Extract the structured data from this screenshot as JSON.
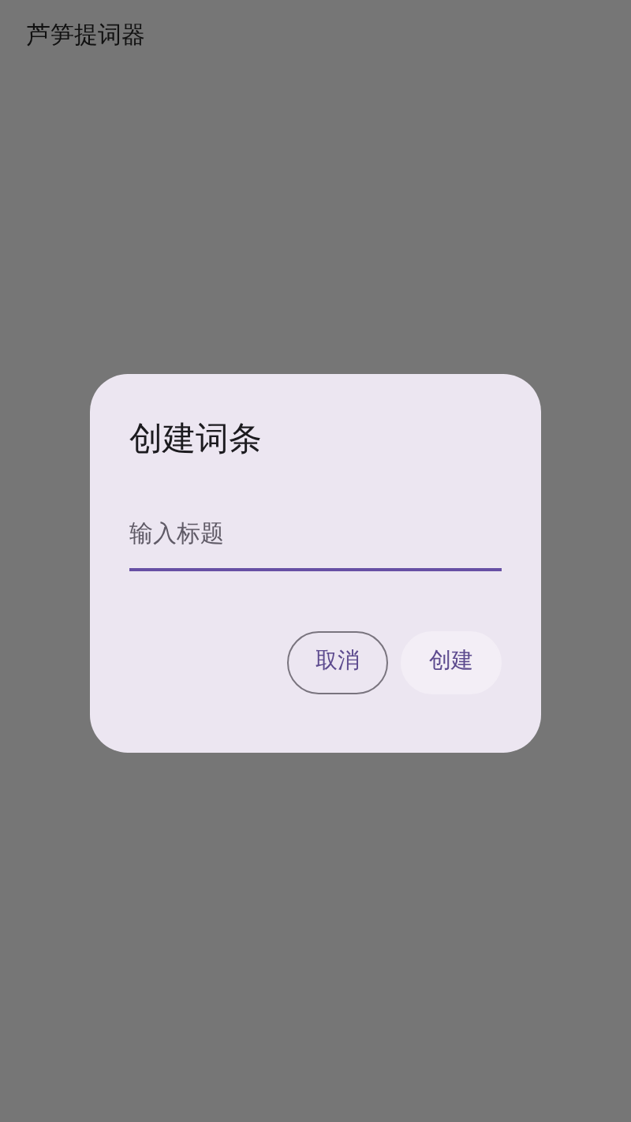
{
  "app_bar": {
    "title": "芦笋提词器"
  },
  "dialog": {
    "title": "创建词条",
    "field": {
      "placeholder": "输入标题"
    },
    "buttons": [
      {
        "label": "取消",
        "kind": "outlined"
      },
      {
        "label": "创建",
        "kind": "tonal"
      }
    ]
  }
}
